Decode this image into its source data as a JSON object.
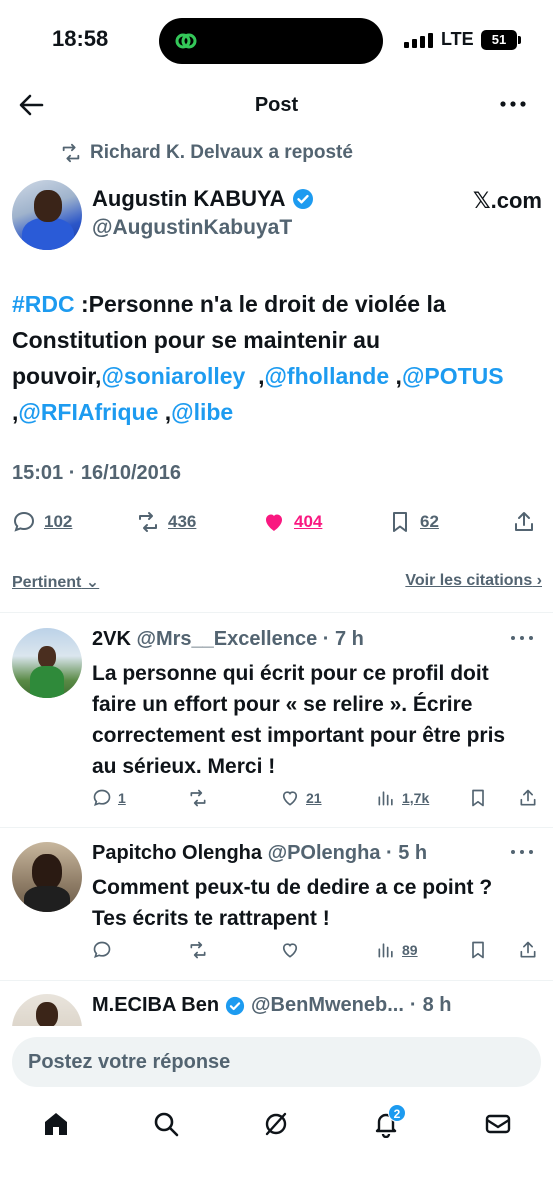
{
  "status": {
    "time": "18:58",
    "network": "LTE",
    "battery": "51"
  },
  "nav": {
    "title": "Post"
  },
  "repost": {
    "text": "Richard K. Delvaux a reposté"
  },
  "author": {
    "name": "Augustin KABUYA",
    "handle": "@AugustinKabuyaT",
    "source": "𝕏.com"
  },
  "tweet": {
    "hashtag": "#RDC",
    "text": " :Personne n'a le droit de violée la Constitution pour se maintenir au pouvoir,",
    "mentions": [
      "@soniarolley",
      "@fhollande",
      "@POTUS",
      "@RFIAfrique",
      "@libe"
    ],
    "timestamp": "15:01 · 16/10/2016",
    "replies": "102",
    "reposts": "436",
    "likes": "404",
    "bookmarks": "62"
  },
  "sort": {
    "left": "Pertinent",
    "right": "Voir les citations"
  },
  "replies": [
    {
      "name": "2VK",
      "handle": "@Mrs__Excellence",
      "time": "7 h",
      "text": "La personne qui écrit pour ce profil doit faire un effort pour « se relire ». Écrire correctement est important pour être pris au sérieux. Merci !",
      "replies": "1",
      "reposts": "",
      "likes": "21",
      "views": "1,7k"
    },
    {
      "name": "Papitcho Olengha",
      "handle": "@POlengha",
      "time": "5 h",
      "text": "Comment peux-tu de dedire a ce point ? Tes écrits te rattrapent !",
      "replies": "",
      "reposts": "",
      "likes": "",
      "views": "89"
    },
    {
      "name": "M.ECIBA Ben",
      "handle": "@BenMweneb...",
      "time": "8 h"
    }
  ],
  "reply_box": {
    "placeholder": "Postez votre réponse"
  },
  "tabbar": {
    "notifications_badge": "2"
  },
  "colors": {
    "accent": "#1d9bf0",
    "like": "#f91880",
    "muted": "#536471"
  }
}
